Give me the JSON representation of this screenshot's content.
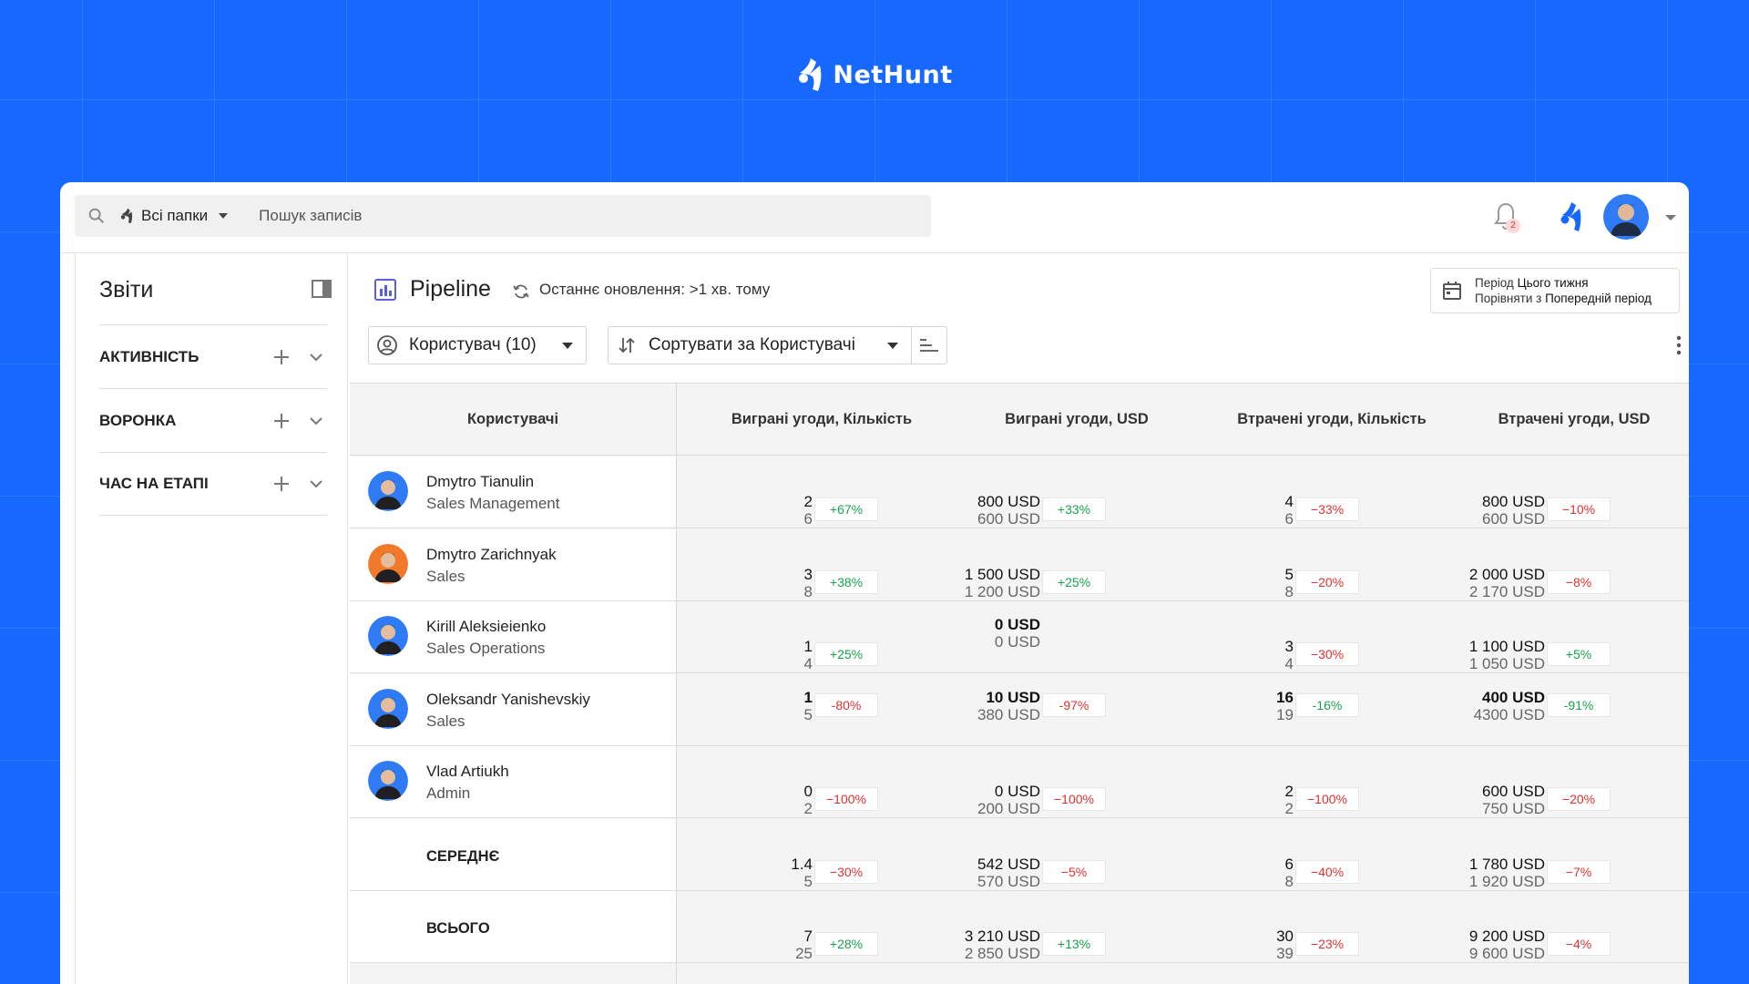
{
  "brand": {
    "name": "NetHunt"
  },
  "topbar": {
    "folder_label": "Всі папки",
    "search_placeholder": "Пошук записів",
    "notification_count": "2"
  },
  "sidebar": {
    "title": "Звіти",
    "sections": [
      {
        "label": "АКТИВНІСТЬ"
      },
      {
        "label": "ВОРОНКА"
      },
      {
        "label": "ЧАС НА ЕТАПІ"
      }
    ]
  },
  "report": {
    "title": "Pipeline",
    "last_update": "Останнє оновлення: >1 хв. тому",
    "period_line1_prefix": "Період",
    "period_line1_value": "Цього тижня",
    "period_line2_prefix": "Порівняти з",
    "period_line2_value": "Попередній період",
    "filter_user_label": "Користувач (10)",
    "sort_prefix": "Сортувати за",
    "sort_value": "Користувачі"
  },
  "table": {
    "headers": [
      "Користувачі",
      "Виграні угоди, Кількість",
      "Виграні угоди, USD",
      "Втрачені угоди, Кількість",
      "Втрачені угоди, USD"
    ],
    "rows": [
      {
        "name": "Dmytro Tianulin",
        "role": "Sales Management",
        "cells": [
          {
            "cur": "2",
            "prev": "6",
            "delta": "+67%",
            "trend": "up"
          },
          {
            "cur": "800 USD",
            "prev": "600 USD",
            "delta": "+33%",
            "trend": "up"
          },
          {
            "cur": "4",
            "prev": "6",
            "delta": "−33%",
            "trend": "down"
          },
          {
            "cur": "800 USD",
            "prev": "600 USD",
            "delta": "−10%",
            "trend": "down"
          }
        ]
      },
      {
        "name": "Dmytro Zarichnyak",
        "role": "Sales",
        "cells": [
          {
            "cur": "3",
            "prev": "8",
            "delta": "+38%",
            "trend": "up"
          },
          {
            "cur": "1 500 USD",
            "prev": "1 200 USD",
            "delta": "+25%",
            "trend": "up"
          },
          {
            "cur": "5",
            "prev": "8",
            "delta": "−20%",
            "trend": "down"
          },
          {
            "cur": "2 000 USD",
            "prev": "2 170 USD",
            "delta": "−8%",
            "trend": "down"
          }
        ]
      },
      {
        "name": "Kirill Aleksieienko",
        "role": "Sales Operations",
        "cells": [
          {
            "cur": "1",
            "prev": "4",
            "delta": "+25%",
            "trend": "up"
          },
          {
            "cur": "0 USD",
            "prev": "0 USD",
            "delta": "",
            "trend": "none"
          },
          {
            "cur": "3",
            "prev": "4",
            "delta": "−30%",
            "trend": "down"
          },
          {
            "cur": "1 100 USD",
            "prev": "1 050 USD",
            "delta": "+5%",
            "trend": "up"
          }
        ]
      },
      {
        "name": "Oleksandr Yanishevskiy",
        "role": "Sales",
        "cells": [
          {
            "cur": "1",
            "prev": "5",
            "delta": "-80%",
            "trend": "down"
          },
          {
            "cur": "10 USD",
            "prev": "380 USD",
            "delta": "-97%",
            "trend": "down"
          },
          {
            "cur": "16",
            "prev": "19",
            "delta": "-16%",
            "trend": "up"
          },
          {
            "cur": "400 USD",
            "prev": "4300 USD",
            "delta": "-91%",
            "trend": "up"
          }
        ]
      },
      {
        "name": "Vlad Artiukh",
        "role": "Admin",
        "cells": [
          {
            "cur": "0",
            "prev": "2",
            "delta": "−100%",
            "trend": "down"
          },
          {
            "cur": "0 USD",
            "prev": "200 USD",
            "delta": "−100%",
            "trend": "down"
          },
          {
            "cur": "2",
            "prev": "2",
            "delta": "−100%",
            "trend": "down"
          },
          {
            "cur": "600 USD",
            "prev": "750 USD",
            "delta": "−20%",
            "trend": "down"
          }
        ]
      },
      {
        "name": "СЕРЕДНЄ",
        "role": "",
        "summary": true,
        "cells": [
          {
            "cur": "1.4",
            "prev": "5",
            "delta": "−30%",
            "trend": "down"
          },
          {
            "cur": "542 USD",
            "prev": "570 USD",
            "delta": "−5%",
            "trend": "down"
          },
          {
            "cur": "6",
            "prev": "8",
            "delta": "−40%",
            "trend": "down"
          },
          {
            "cur": "1 780 USD",
            "prev": "1 920 USD",
            "delta": "−7%",
            "trend": "down"
          }
        ]
      },
      {
        "name": "ВСЬОГО",
        "role": "",
        "summary": true,
        "cells": [
          {
            "cur": "7",
            "prev": "25",
            "delta": "+28%",
            "trend": "up"
          },
          {
            "cur": "3 210 USD",
            "prev": "2 850 USD",
            "delta": "+13%",
            "trend": "up"
          },
          {
            "cur": "30",
            "prev": "39",
            "delta": "−23%",
            "trend": "down"
          },
          {
            "cur": "9 200 USD",
            "prev": "9 600 USD",
            "delta": "−4%",
            "trend": "down"
          }
        ]
      }
    ]
  },
  "colors": {
    "brand_blue": "#1668ff",
    "up": "#18a34a",
    "down": "#e03131"
  }
}
